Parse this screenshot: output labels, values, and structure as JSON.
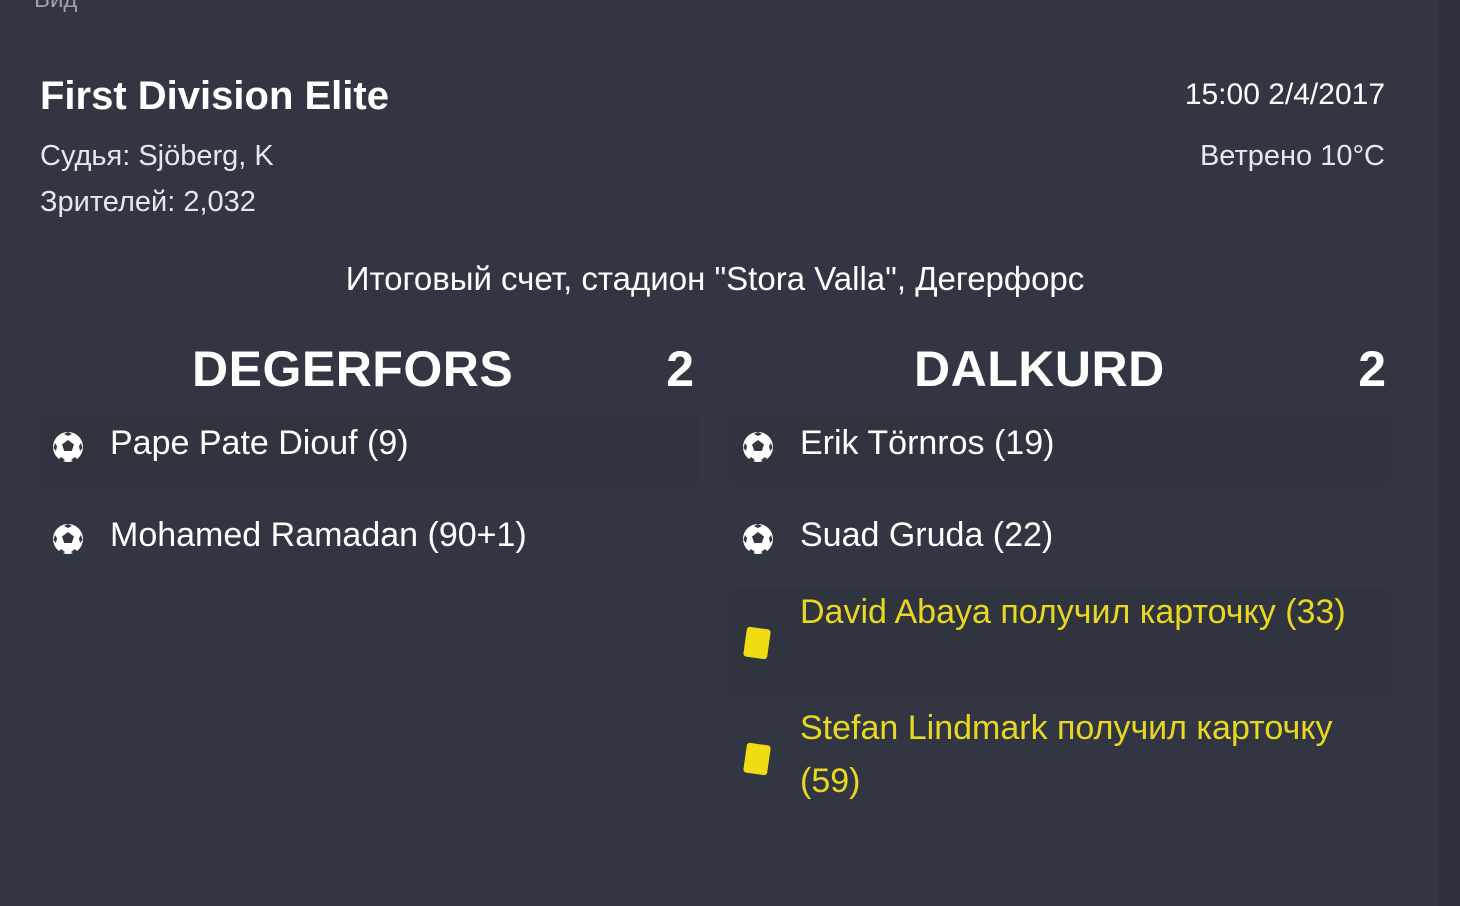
{
  "header": {
    "cut_label": "Вид",
    "competition": "First Division Elite",
    "datetime": "15:00 2/4/2017",
    "referee": "Судья: Sjöberg, K",
    "weather": "Ветрено 10°C",
    "attendance": "Зрителей: 2,032"
  },
  "venue_line": "Итоговый счет, стадион \"Stora Valla\", Дегерфорс",
  "home": {
    "name": "DEGERFORS",
    "score": "2",
    "events": [
      {
        "type": "goal",
        "icon": "football-icon",
        "text": "Pape Pate Diouf (9)"
      },
      {
        "type": "goal",
        "icon": "football-icon",
        "text": "Mohamed Ramadan (90+1)"
      }
    ]
  },
  "away": {
    "name": "DALKURD",
    "score": "2",
    "events": [
      {
        "type": "goal",
        "icon": "football-icon",
        "text": "Erik Törnros (19)"
      },
      {
        "type": "goal",
        "icon": "football-icon",
        "text": "Suad Gruda (22)"
      },
      {
        "type": "yellow_card",
        "icon": "yellow-card-icon",
        "text": "David Abaya получил карточку (33)"
      },
      {
        "type": "yellow_card",
        "icon": "yellow-card-icon",
        "text": "Stefan Lindmark получил карточку (59)"
      }
    ]
  },
  "colors": {
    "background": "#323643",
    "card_text": "#e9d820",
    "card": "#f0dc12"
  }
}
